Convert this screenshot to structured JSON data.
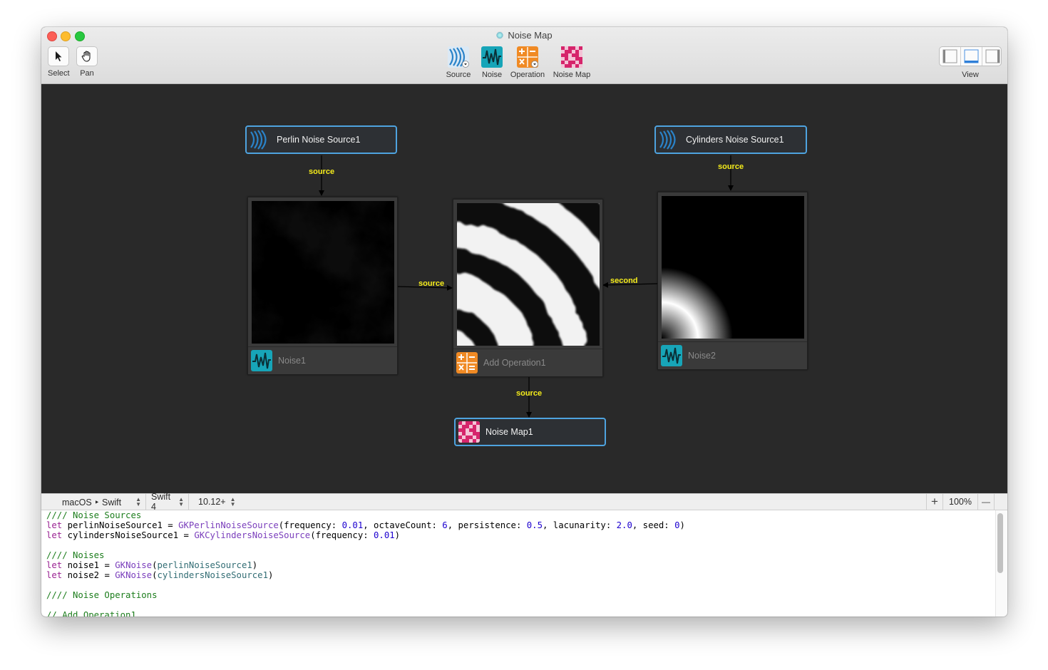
{
  "window": {
    "title": "Noise Map"
  },
  "toolbar": {
    "select_label": "Select",
    "pan_label": "Pan",
    "source_label": "Source",
    "noise_label": "Noise",
    "operation_label": "Operation",
    "noise_map_label": "Noise Map",
    "view_label": "View"
  },
  "nodes": {
    "perlin_source": "Perlin Noise Source1",
    "cylinders_source": "Cylinders Noise Source1",
    "noise1": "Noise1",
    "add_operation": "Add Operation1",
    "noise2": "Noise2",
    "noise_map": "Noise Map1"
  },
  "edges": {
    "perlin_to_noise1": "source",
    "cylinders_to_noise2": "source",
    "noise1_to_add": "source",
    "noise2_to_add": "second",
    "add_to_map": "source"
  },
  "statusbar": {
    "platform": "macOS ‣ Swift",
    "swift_version": "Swift 4",
    "os_version": "10.12+",
    "zoom_in": "+",
    "zoom": "100%",
    "zoom_out": "—"
  },
  "code": {
    "l1": "//// Noise Sources",
    "l2_kw": "let",
    "l2_name": " perlinNoiseSource1 = ",
    "l2_type": "GKPerlinNoiseSource",
    "l2_a": "(frequency: ",
    "l2_n1": "0.01",
    "l2_b": ", octaveCount: ",
    "l2_n2": "6",
    "l2_c": ", persistence: ",
    "l2_n3": "0.5",
    "l2_d": ", lacunarity: ",
    "l2_n4": "2.0",
    "l2_e": ", seed: ",
    "l2_n5": "0",
    "l2_f": ")",
    "l3_kw": "let",
    "l3_name": " cylindersNoiseSource1 = ",
    "l3_type": "GKCylindersNoiseSource",
    "l3_a": "(frequency: ",
    "l3_n1": "0.01",
    "l3_f": ")",
    "l5": "//// Noises",
    "l6_kw": "let",
    "l6_name": " noise1 = ",
    "l6_type": "GKNoise",
    "l6_a": "(",
    "l6_var": "perlinNoiseSource1",
    "l6_f": ")",
    "l7_kw": "let",
    "l7_name": " noise2 = ",
    "l7_type": "GKNoise",
    "l7_a": "(",
    "l7_var": "cylindersNoiseSource1",
    "l7_f": ")",
    "l9": "//// Noise Operations",
    "l11": "// Add Operation1"
  },
  "colors": {
    "node_border": "#4ea3df",
    "edge_label": "#f5ec1a",
    "noise_icon": "#17a5b8",
    "operation_icon": "#f08a24",
    "noise_map_icon": "#d6246b"
  }
}
